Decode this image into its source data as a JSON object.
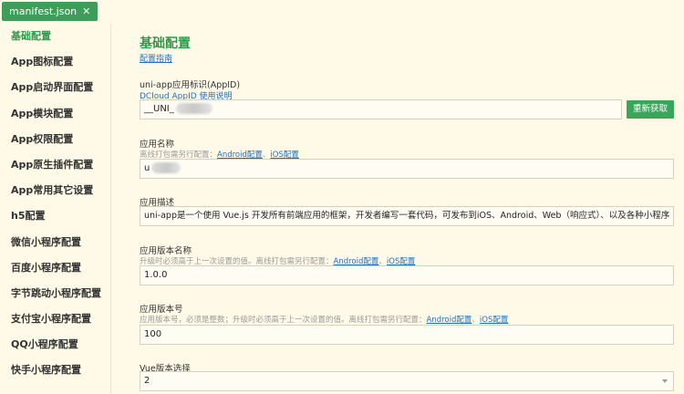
{
  "tab": {
    "title": "manifest.json",
    "close": "✕"
  },
  "sidebar": {
    "items": [
      {
        "label": "基础配置",
        "active": true
      },
      {
        "label": "App图标配置"
      },
      {
        "label": "App启动界面配置"
      },
      {
        "label": "App模块配置"
      },
      {
        "label": "App权限配置"
      },
      {
        "label": "App原生插件配置"
      },
      {
        "label": "App常用其它设置"
      },
      {
        "label": "h5配置"
      },
      {
        "label": "微信小程序配置"
      },
      {
        "label": "百度小程序配置"
      },
      {
        "label": "字节跳动小程序配置"
      },
      {
        "label": "支付宝小程序配置"
      },
      {
        "label": "QQ小程序配置"
      },
      {
        "label": "快手小程序配置"
      }
    ]
  },
  "main": {
    "title": "基础配置",
    "guide_link": "配置指南",
    "appid": {
      "label": "uni-app应用标识(AppID)",
      "help_link": "DCloud AppID 使用说明",
      "value": "__UNI_",
      "refresh_button": "重新获取"
    },
    "app_name": {
      "label": "应用名称",
      "hint": "离线打包需另行配置：",
      "android_link": "Android配置",
      "sep": "、",
      "ios_link": "iOS配置",
      "value": "u"
    },
    "app_desc": {
      "label": "应用描述",
      "value": "uni-app是一个使用 Vue.js 开发所有前端应用的框架，开发者编写一套代码，可发布到iOS、Android、Web（响应式）、以及各种小程序"
    },
    "version_name": {
      "label": "应用版本名称",
      "hint": "升级时必须高于上一次设置的值。离线打包需另行配置：",
      "android_link": "Android配置",
      "sep": "、",
      "ios_link": "iOS配置",
      "value": "1.0.0"
    },
    "version_code": {
      "label": "应用版本号",
      "hint": "应用版本号，必须是整数；升级时必须高于上一次设置的值。离线打包需另行配置：",
      "android_link": "Android配置",
      "sep": "、",
      "ios_link": "iOS配置",
      "value": "100"
    },
    "vue_version": {
      "label": "Vue版本选择",
      "value": "2"
    }
  }
}
